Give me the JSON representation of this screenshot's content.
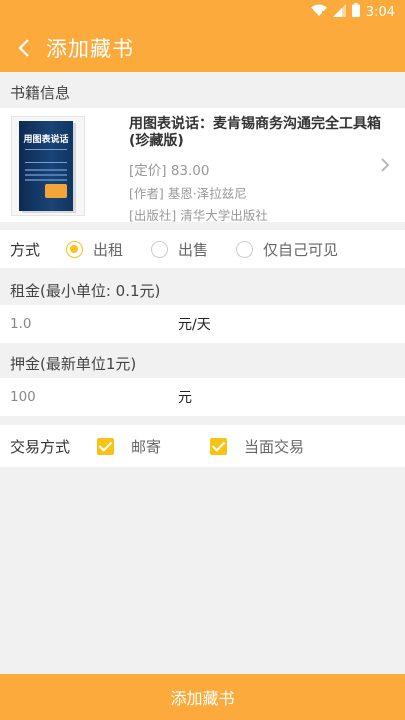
{
  "status_bar": {
    "time": "3:04"
  },
  "toolbar": {
    "title": "添加藏书"
  },
  "book_section": {
    "heading": "书籍信息"
  },
  "book": {
    "cover_title": "用图表说话",
    "title": "用图表说话：麦肯锡商务沟通完全工具箱(珍藏版)",
    "price": "[定价] 83.00",
    "author": "[作者] 基恩·泽拉兹尼",
    "publisher": "[出版社] 清华大学出版社"
  },
  "mode": {
    "label": "方式",
    "options": [
      {
        "label": "出租",
        "checked": true
      },
      {
        "label": "出售",
        "checked": false
      },
      {
        "label": "仅自己可见",
        "checked": false
      }
    ]
  },
  "rent": {
    "label": "租金(最小单位: 0.1元)",
    "value": "1.0",
    "unit": "元/天"
  },
  "deposit": {
    "label": "押金(最新单位1元)",
    "value": "100",
    "unit": "元"
  },
  "trade": {
    "label": "交易方式",
    "options": [
      {
        "label": "邮寄",
        "checked": true
      },
      {
        "label": "当面交易",
        "checked": true
      }
    ]
  },
  "submit": {
    "label": "添加藏书"
  },
  "colors": {
    "accent": "#fcaa3c",
    "check": "#f9c316",
    "background": "#f1f1f1"
  }
}
